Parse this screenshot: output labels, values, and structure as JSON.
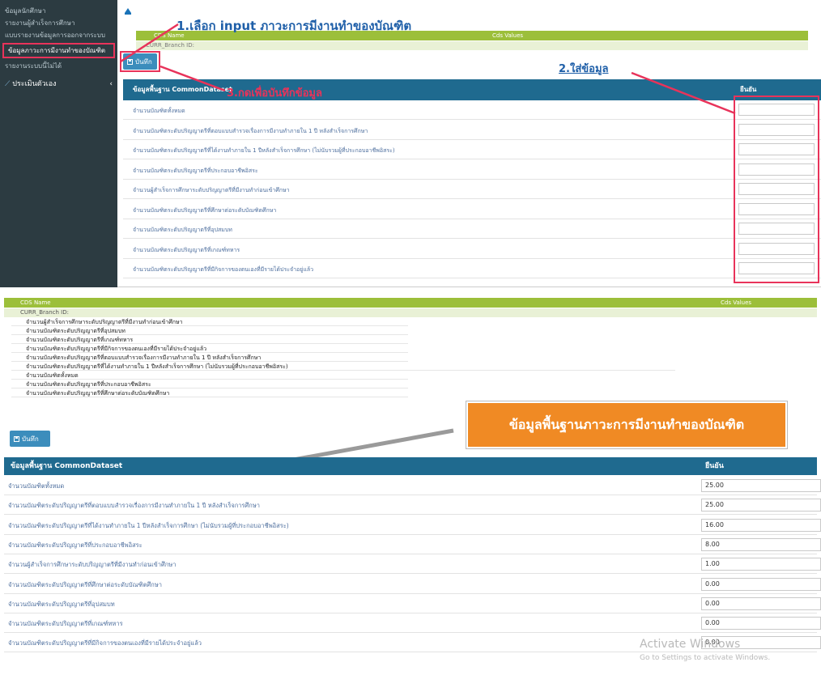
{
  "sidebar": {
    "items": [
      {
        "label": "ข้อมูลนักศึกษา"
      },
      {
        "label": "รายงานผู้สำเร็จการศึกษา"
      },
      {
        "label": "แบบรายงานข้อมูลการออกจากระบบ"
      },
      {
        "label": "ข้อมูลภาวะการมีงานทำของบัณฑิต"
      },
      {
        "label": "รายงานระบบนี้ไม่ได้"
      },
      {
        "label": "ประเมินตัวเอง"
      }
    ]
  },
  "top": {
    "kv_header": {
      "name": "CDS Name",
      "value": "Cds Values"
    },
    "kv_row": "CURR_Branch ID:",
    "save_label": "บันทึก",
    "table_header": {
      "name": "ข้อมูลพื้นฐาน CommonDataset",
      "value": "ยืนยัน"
    },
    "rows": [
      "จำนวนบัณฑิตทั้งหมด",
      "จำนวนบัณฑิตระดับปริญญาตรีที่ตอบแบบสำรวจเรื่องการมีงานทำภายใน 1 ปี หลังสำเร็จการศึกษา",
      "จำนวนบัณฑิตระดับปริญญาตรีที่ได้งานทำภายใน 1 ปีหลังสำเร็จการศึกษา (ไม่นับรวมผู้ที่ประกอบอาชีพอิสระ)",
      "จำนวนบัณฑิตระดับปริญญาตรีที่ประกอบอาชีพอิสระ",
      "จำนวนผู้สำเร็จการศึกษาระดับปริญญาตรีที่มีงานทำก่อนเข้าศึกษา",
      "จำนวนบัณฑิตระดับปริญญาตรีที่ศึกษาต่อระดับบัณฑิตศึกษา",
      "จำนวนบัณฑิตระดับปริญญาตรีที่อุปสมบท",
      "จำนวนบัณฑิตระดับปริญญาตรีที่เกณฑ์ทหาร",
      "จำนวนบัณฑิตระดับปริญญาตรีที่มีกิจการของตนเองที่มีรายได้ประจำอยู่แล้ว"
    ],
    "callouts": {
      "step1": "1.เลือก input ภาวะการมีงานทำของบัณฑิต",
      "step2": "2.ใส่ข้อมูล",
      "step3": "3.กดเพื่อบันทึกข้อมูล"
    }
  },
  "bottom": {
    "kv_header": {
      "name": "CDS Name",
      "value": "Cds Values"
    },
    "branch_row": "CURR_Branch ID:",
    "sub_rows": [
      "จำนวนผู้สำเร็จการศึกษาระดับปริญญาตรีที่มีงานทำก่อนเข้าศึกษา",
      "จำนวนบัณฑิตระดับปริญญาตรีที่อุปสมบท",
      "จำนวนบัณฑิตระดับปริญญาตรีที่เกณฑ์ทหาร",
      "จำนวนบัณฑิตระดับปริญญาตรีที่มีกิจการของตนเองที่มีรายได้ประจำอยู่แล้ว",
      "จำนวนบัณฑิตระดับปริญญาตรีที่ตอบแบบสำรวจเรื่องการมีงานทำภายใน 1 ปี หลังสำเร็จการศึกษา",
      "จำนวนบัณฑิตระดับปริญญาตรีที่ได้งานทำภายใน 1 ปีหลังสำเร็จการศึกษา (ไม่นับรวมผู้ที่ประกอบอาชีพอิสระ)",
      "จำนวนบัณฑิตทั้งหมด",
      "จำนวนบัณฑิตระดับปริญญาตรีที่ประกอบอาชีพอิสระ",
      "จำนวนบัณฑิตระดับปริญญาตรีที่ศึกษาต่อระดับบัณฑิตศึกษา"
    ],
    "save_label": "บันทึก",
    "note": "ข้อมูลพื้นฐานภาวะการมีงานทำของบัณฑิต",
    "table_header": {
      "name": "ข้อมูลพื้นฐาน CommonDataset",
      "value": "ยืนยัน"
    },
    "rows": [
      {
        "label": "จำนวนบัณฑิตทั้งหมด",
        "value": "25.00"
      },
      {
        "label": "จำนวนบัณฑิตระดับปริญญาตรีที่ตอบแบบสำรวจเรื่องการมีงานทำภายใน 1 ปี หลังสำเร็จการศึกษา",
        "value": "25.00"
      },
      {
        "label": "จำนวนบัณฑิตระดับปริญญาตรีที่ได้งานทำภายใน 1 ปีหลังสำเร็จการศึกษา (ไม่นับรวมผู้ที่ประกอบอาชีพอิสระ)",
        "value": "16.00"
      },
      {
        "label": "จำนวนบัณฑิตระดับปริญญาตรีที่ประกอบอาชีพอิสระ",
        "value": "8.00"
      },
      {
        "label": "จำนวนผู้สำเร็จการศึกษาระดับปริญญาตรีที่มีงานทำก่อนเข้าศึกษา",
        "value": "1.00"
      },
      {
        "label": "จำนวนบัณฑิตระดับปริญญาตรีที่ศึกษาต่อระดับบัณฑิตศึกษา",
        "value": "0.00"
      },
      {
        "label": "จำนวนบัณฑิตระดับปริญญาตรีที่อุปสมบท",
        "value": "0.00"
      },
      {
        "label": "จำนวนบัณฑิตระดับปริญญาตรีที่เกณฑ์ทหาร",
        "value": "0.00"
      },
      {
        "label": "จำนวนบัณฑิตระดับปริญญาตรีที่มีกิจการของตนเองที่มีรายได้ประจำอยู่แล้ว",
        "value": "0.00"
      }
    ],
    "watermark": {
      "line1": "Activate Windows",
      "line2": "Go to Settings to activate Windows."
    }
  },
  "colors": {
    "callout_red": "#e8335a",
    "header_blue": "#1f6a8f",
    "kv_green": "#9cbf3a",
    "note_orange": "#f08a24",
    "button_blue": "#3c8dbc"
  },
  "icons": [
    "upload-icon",
    "save-disk-icon",
    "chart-line-icon",
    "chevron-left-icon"
  ]
}
